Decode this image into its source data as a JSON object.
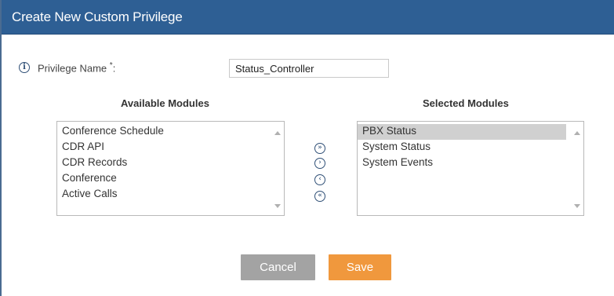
{
  "dialog": {
    "title": "Create New Custom Privilege"
  },
  "form": {
    "privilege_name_label": "Privilege Name",
    "required_marker": "*",
    "label_colon": ":",
    "privilege_name_value": "Status_Controller"
  },
  "available": {
    "heading": "Available Modules",
    "items": [
      "Conference Schedule",
      "CDR API",
      "CDR Records",
      "Conference",
      "Active Calls"
    ]
  },
  "selected": {
    "heading": "Selected Modules",
    "items": [
      "PBX Status",
      "System Status",
      "System Events"
    ],
    "highlighted_index": 0
  },
  "move_buttons": {
    "move_all_right_glyph": "»",
    "move_right_glyph": "›",
    "move_left_glyph": "‹",
    "move_all_left_glyph": "«"
  },
  "buttons": {
    "cancel_label": "Cancel",
    "save_label": "Save"
  },
  "colors": {
    "title_bar": "#2e5f94",
    "save_button": "#f0983d",
    "cancel_button": "#a3a3a3",
    "selected_row": "#d0d0d0"
  }
}
